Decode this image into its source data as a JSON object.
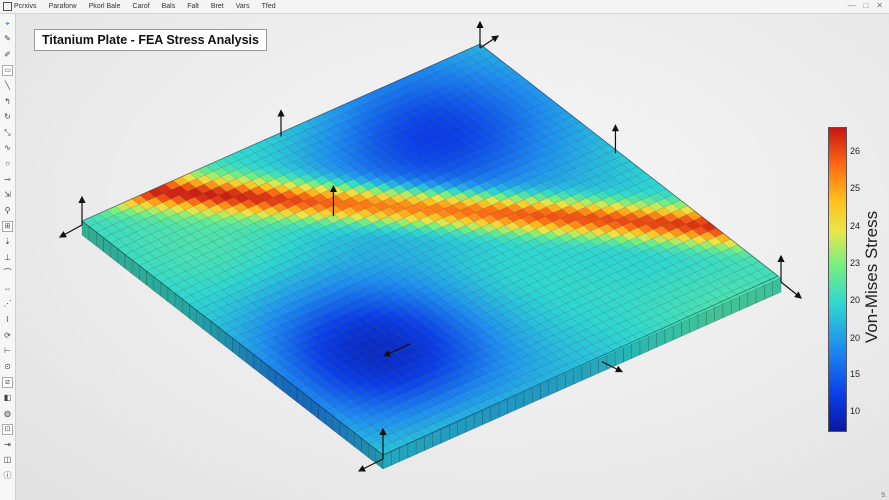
{
  "menu": {
    "items": [
      "Pcrxivs",
      "Paraforw",
      "Pkorl Bale",
      "Carof",
      "Bals",
      "Falt",
      "Bret",
      "Vars",
      "Tfed"
    ]
  },
  "window": {
    "controls": [
      "—",
      "□",
      "✕"
    ],
    "corner_text": "9."
  },
  "toolbar": {
    "tools": [
      {
        "name": "select-icon",
        "glyph": "⌖"
      },
      {
        "name": "pencil-icon",
        "glyph": "✎"
      },
      {
        "name": "brush-icon",
        "glyph": "✐"
      },
      {
        "name": "frame-icon",
        "glyph": "▭"
      },
      {
        "name": "line-icon",
        "glyph": "╲"
      },
      {
        "name": "bend-icon",
        "glyph": "↰"
      },
      {
        "name": "rotate-icon",
        "glyph": "↻"
      },
      {
        "name": "pan-icon",
        "glyph": "⤡"
      },
      {
        "name": "curve-icon",
        "glyph": "∿"
      },
      {
        "name": "node-icon",
        "glyph": "○"
      },
      {
        "name": "constraint-icon",
        "glyph": "⊸"
      },
      {
        "name": "force-icon",
        "glyph": "⇲"
      },
      {
        "name": "pin-icon",
        "glyph": "⚲"
      },
      {
        "name": "mesh-icon",
        "glyph": "⊞"
      },
      {
        "name": "load-icon",
        "glyph": "⇣"
      },
      {
        "name": "support-icon",
        "glyph": "⊥"
      },
      {
        "name": "arc-icon",
        "glyph": "⌒"
      },
      {
        "name": "stretch-icon",
        "glyph": "⇔"
      },
      {
        "name": "shear-icon",
        "glyph": "⋰"
      },
      {
        "name": "spring-icon",
        "glyph": "⌇"
      },
      {
        "name": "refresh-icon",
        "glyph": "⟳"
      },
      {
        "name": "measure-icon",
        "glyph": "⊢"
      },
      {
        "name": "probe-icon",
        "glyph": "⊙"
      },
      {
        "name": "section-icon",
        "glyph": "⧄"
      },
      {
        "name": "result-icon",
        "glyph": "◧"
      },
      {
        "name": "contour-icon",
        "glyph": "◍"
      },
      {
        "name": "clip-icon",
        "glyph": "⊡"
      },
      {
        "name": "export-icon",
        "glyph": "⇥"
      },
      {
        "name": "camera-icon",
        "glyph": "◫"
      },
      {
        "name": "info-icon",
        "glyph": "ⓘ"
      }
    ]
  },
  "viewport": {
    "title": "Titanium Plate - FEA Stress Analysis"
  },
  "legend": {
    "label": "Von-Mises Stress",
    "ticks": [
      "26",
      "25",
      "24",
      "23",
      "20",
      "20",
      "15",
      "10"
    ],
    "colors": [
      "#0a18a0",
      "#0a3ee8",
      "#1f8ff0",
      "#2fd7d0",
      "#77f07e",
      "#e9e64a",
      "#ffc01e",
      "#ff6a12",
      "#c81414"
    ]
  }
}
